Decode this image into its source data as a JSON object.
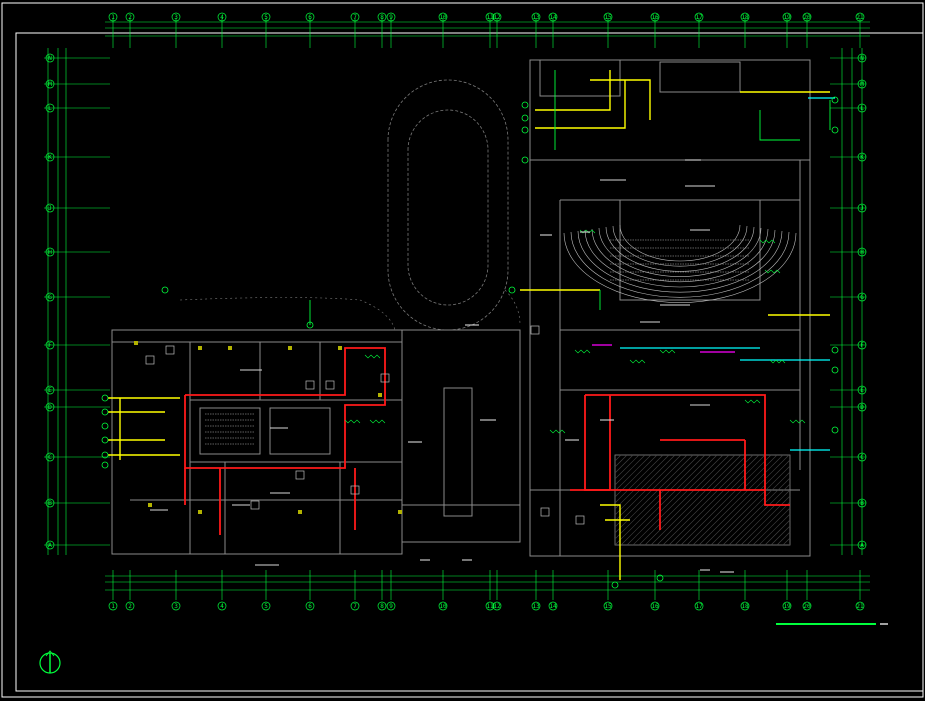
{
  "drawing": {
    "colors": {
      "background": "#000000",
      "frame": "#ffffff",
      "gridline": "#00ff3c",
      "wall": "#8a8a8a",
      "fire_pipe": "#ff1a1a",
      "water_pipe": "#ffff00",
      "drain_pipe": "#00ffff",
      "gas_pipe": "#ff00ff",
      "annotation": "#d8d8d8"
    },
    "top_axis_labels": [
      "1",
      "2",
      "3",
      "4",
      "5",
      "6",
      "7",
      "8",
      "9",
      "10",
      "11",
      "12",
      "13",
      "14",
      "15",
      "16",
      "17",
      "18",
      "19",
      "20",
      "21"
    ],
    "bottom_axis_labels": [
      "1",
      "2",
      "3",
      "4",
      "5",
      "6",
      "7",
      "8",
      "9",
      "10",
      "11",
      "12",
      "13",
      "14",
      "15",
      "16",
      "17",
      "18",
      "19",
      "20",
      "21"
    ],
    "left_axis_labels": [
      "N",
      "M",
      "L",
      "K",
      "J",
      "H",
      "G",
      "F",
      "E",
      "D",
      "C",
      "B",
      "A"
    ],
    "right_axis_labels": [
      "N",
      "M",
      "L",
      "K",
      "J",
      "H",
      "G",
      "F",
      "E",
      "D",
      "C",
      "B",
      "A"
    ],
    "icons": [
      "north-arrow-icon"
    ]
  }
}
